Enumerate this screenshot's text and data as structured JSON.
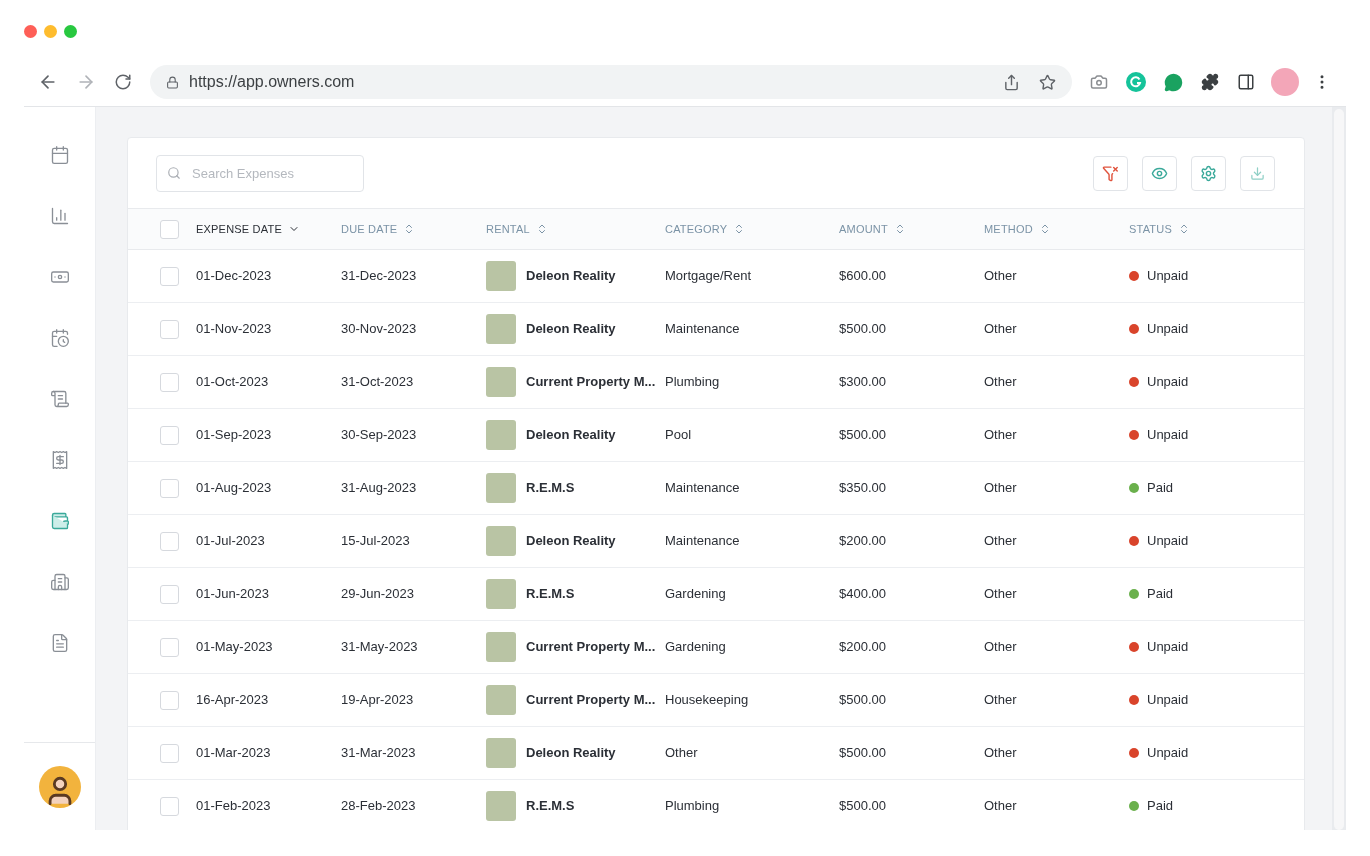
{
  "browser": {
    "url": "https://app.owners.com"
  },
  "sidebar": {
    "items": [
      {
        "selected": false
      },
      {
        "selected": false
      },
      {
        "selected": false
      },
      {
        "selected": false
      },
      {
        "selected": false
      },
      {
        "selected": false
      },
      {
        "selected": true
      },
      {
        "selected": false
      },
      {
        "selected": false
      }
    ]
  },
  "search": {
    "placeholder": "Search Expenses"
  },
  "table": {
    "all_checked": false,
    "columns": [
      {
        "label": "EXPENSE DATE",
        "sorted": true
      },
      {
        "label": "DUE DATE",
        "sorted": false
      },
      {
        "label": "RENTAL",
        "sorted": false
      },
      {
        "label": "CATEGORY",
        "sorted": false
      },
      {
        "label": "AMOUNT",
        "sorted": false
      },
      {
        "label": "METHOD",
        "sorted": false
      },
      {
        "label": "STATUS",
        "sorted": false
      }
    ],
    "rows": [
      {
        "checked": false,
        "expense_date": "01-Dec-2023",
        "due_date": "31-Dec-2023",
        "rental": "Deleon Reality",
        "category": "Mortgage/Rent",
        "amount": "$600.00",
        "method": "Other",
        "status": "Unpaid",
        "color": "#d9442b"
      },
      {
        "checked": false,
        "expense_date": "01-Nov-2023",
        "due_date": "30-Nov-2023",
        "rental": "Deleon Reality",
        "category": "Maintenance",
        "amount": "$500.00",
        "method": "Other",
        "status": "Unpaid",
        "color": "#d9442b"
      },
      {
        "checked": false,
        "expense_date": "01-Oct-2023",
        "due_date": "31-Oct-2023",
        "rental": "Current Property M...",
        "category": "Plumbing",
        "amount": "$300.00",
        "method": "Other",
        "status": "Unpaid",
        "color": "#d9442b"
      },
      {
        "checked": false,
        "expense_date": "01-Sep-2023",
        "due_date": "30-Sep-2023",
        "rental": "Deleon Reality",
        "category": "Pool",
        "amount": "$500.00",
        "method": "Other",
        "status": "Unpaid",
        "color": "#d9442b"
      },
      {
        "checked": false,
        "expense_date": "01-Aug-2023",
        "due_date": "31-Aug-2023",
        "rental": "R.E.M.S",
        "category": "Maintenance",
        "amount": "$350.00",
        "method": "Other",
        "status": "Paid",
        "color": "#6ab04c"
      },
      {
        "checked": false,
        "expense_date": "01-Jul-2023",
        "due_date": "15-Jul-2023",
        "rental": "Deleon Reality",
        "category": "Maintenance",
        "amount": "$200.00",
        "method": "Other",
        "status": "Unpaid",
        "color": "#d9442b"
      },
      {
        "checked": false,
        "expense_date": "01-Jun-2023",
        "due_date": "29-Jun-2023",
        "rental": "R.E.M.S",
        "category": "Gardening",
        "amount": "$400.00",
        "method": "Other",
        "status": "Paid",
        "color": "#6ab04c"
      },
      {
        "checked": false,
        "expense_date": "01-May-2023",
        "due_date": "31-May-2023",
        "rental": "Current Property M...",
        "category": "Gardening",
        "amount": "$200.00",
        "method": "Other",
        "status": "Unpaid",
        "color": "#d9442b"
      },
      {
        "checked": false,
        "expense_date": "16-Apr-2023",
        "due_date": "19-Apr-2023",
        "rental": "Current Property M...",
        "category": "Housekeeping",
        "amount": "$500.00",
        "method": "Other",
        "status": "Unpaid",
        "color": "#d9442b"
      },
      {
        "checked": false,
        "expense_date": "01-Mar-2023",
        "due_date": "31-Mar-2023",
        "rental": "Deleon Reality",
        "category": "Other",
        "amount": "$500.00",
        "method": "Other",
        "status": "Unpaid",
        "color": "#d9442b"
      },
      {
        "checked": false,
        "expense_date": "01-Feb-2023",
        "due_date": "28-Feb-2023",
        "rental": "R.E.M.S",
        "category": "Plumbing",
        "amount": "$500.00",
        "method": "Other",
        "status": "Paid",
        "color": "#6ab04c"
      }
    ]
  }
}
